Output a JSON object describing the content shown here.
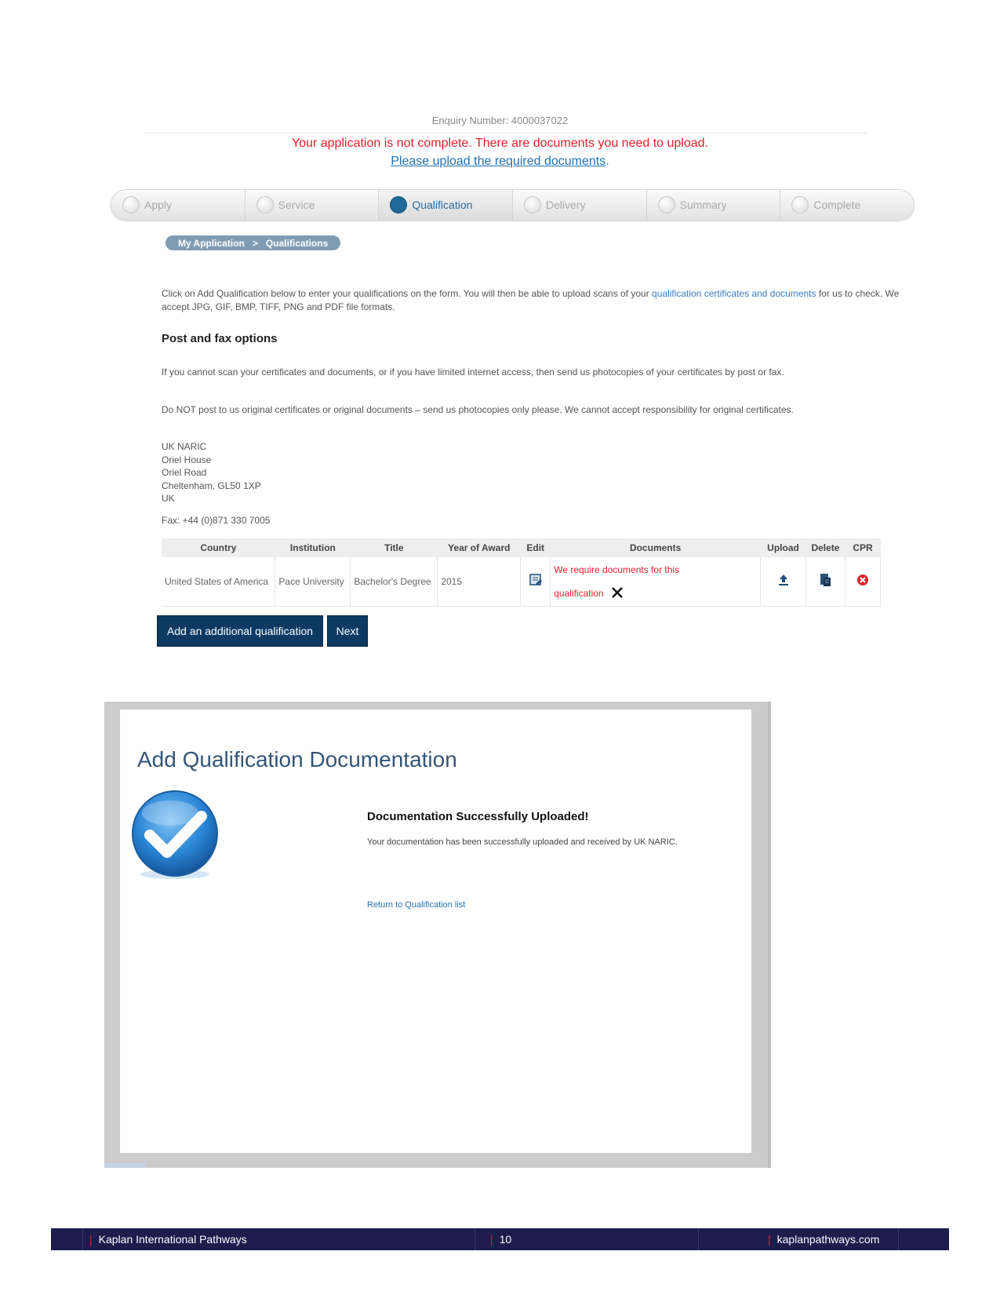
{
  "app": {
    "enquiry_label": "Enquiry Number: 4000037022",
    "warning": "Your application is not complete. There are documents you need to upload.",
    "upload_link": "Please upload the required documents",
    "upload_link_suffix": "."
  },
  "steps": [
    {
      "label": "Apply",
      "active": false
    },
    {
      "label": "Service",
      "active": false
    },
    {
      "label": "Qualification",
      "active": true
    },
    {
      "label": "Delivery",
      "active": false
    },
    {
      "label": "Summary",
      "active": false
    },
    {
      "label": "Complete",
      "active": false
    }
  ],
  "breadcrumb": {
    "home": "My Application",
    "separator": ">",
    "current": "Qualifications"
  },
  "intro": {
    "text_before": "Click on Add Qualification below to enter your qualifications on the form.  You will then be able to upload scans of your ",
    "link": "qualification certificates and documents",
    "text_after": " for us to check. We accept JPG, GIF, BMP, TIFF, PNG and PDF file formats."
  },
  "post_fax": {
    "heading": "Post and fax options",
    "para1": "If you cannot scan your certificates and documents, or if you have limited internet access, then send us photocopies of your certificates by post or fax.",
    "para2": "Do NOT post to us original certificates or original documents – send us photocopies only please. We cannot accept responsibility for original certificates.",
    "address": [
      "UK NARIC",
      "Oriel House",
      "Oriel Road",
      "Cheltenham, GL50 1XP",
      "UK"
    ],
    "fax": "Fax: +44 (0)871 330 7005"
  },
  "table": {
    "headers": [
      "Country",
      "Institution",
      "Title",
      "Year of Award",
      "Edit",
      "Documents",
      "Upload",
      "Delete",
      "CPR"
    ],
    "row": {
      "country": "United States of America",
      "institution": "Pace University",
      "title": "Bachelor's Degree",
      "year": "2015",
      "documents_line1": "We require documents for this",
      "documents_line2": "qualification"
    }
  },
  "buttons": {
    "add": "Add an additional qualification",
    "next": "Next"
  },
  "modal": {
    "title": "Add Qualification Documentation",
    "success_heading": "Documentation Successfully Uploaded!",
    "success_text": "Your documentation has been successfully uploaded and received by UK NARIC.",
    "return_link": "Return to Qualification list"
  },
  "footer": {
    "company": "Kaplan International Pathways",
    "page": "10",
    "url": "kaplanpathways.com"
  },
  "colors": {
    "warning": "#e0222b",
    "link": "#1f6fb5",
    "button": "#0d3a63",
    "footer": "#1c1c4d",
    "footer_bar": "#d9243c"
  },
  "icons": [
    "edit-icon",
    "remove-x-icon",
    "upload-icon",
    "delete-icon",
    "cpr-error-icon",
    "success-check-icon"
  ]
}
